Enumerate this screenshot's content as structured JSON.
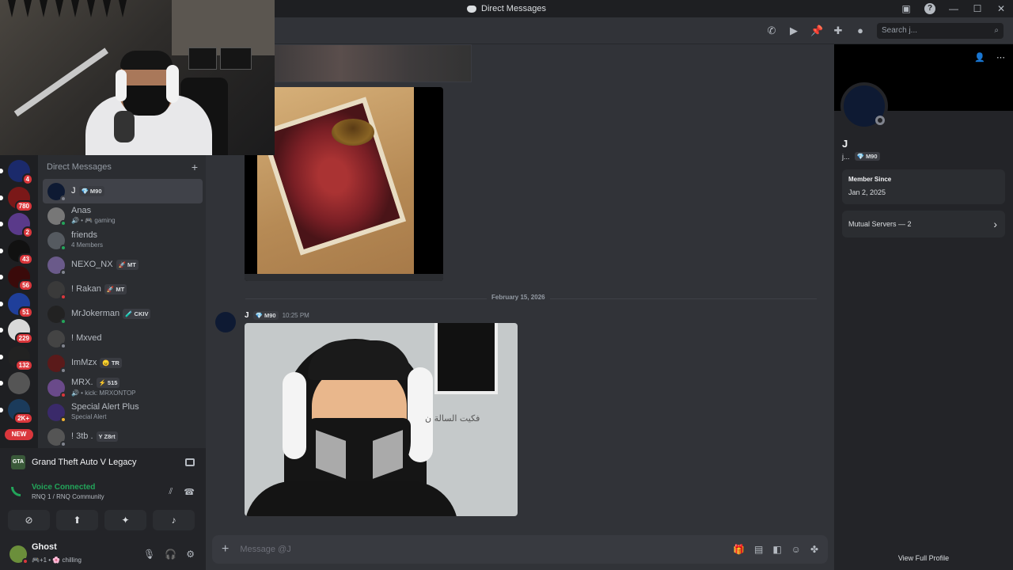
{
  "window": {
    "title": "Direct Messages",
    "minimize": "—",
    "maximize": "☐",
    "close": "✕",
    "help": "?"
  },
  "servers": [
    {
      "badge": "4",
      "color": "#1b2a6b"
    },
    {
      "badge": "780",
      "color": "#7a1818"
    },
    {
      "badge": "2",
      "color": "#5a3a8a"
    },
    {
      "badge": "43",
      "color": "#111111"
    },
    {
      "badge": "56",
      "color": "#3a0a0a"
    },
    {
      "badge": "51",
      "color": "#1f3f9a"
    },
    {
      "badge": "229",
      "color": "#d9d9d9"
    },
    {
      "badge": "132",
      "color": "#222222"
    },
    {
      "badge": "",
      "color": "#555555"
    },
    {
      "badge": "2K+",
      "color": "#1b3b5b"
    }
  ],
  "new_pill": "NEW",
  "dm_list": {
    "header": "Direct Messages",
    "add": "+",
    "items": [
      {
        "name": "J",
        "tag": "💎 M90",
        "sub": "",
        "avatar": "#0e1a33",
        "status": "#80848e",
        "active": true
      },
      {
        "name": "Anas",
        "tag": "",
        "sub": "🔊 • 🎮 gaming",
        "avatar": "#777777",
        "status": "#23a55a",
        "active": false
      },
      {
        "name": "friends",
        "tag": "",
        "sub": "4 Members",
        "avatar": "#555a60",
        "status": "#23a55a",
        "active": false
      },
      {
        "name": "NEXO_NX",
        "tag": "🚀 MT",
        "sub": "",
        "avatar": "#6a5a8a",
        "status": "#80848e",
        "active": false
      },
      {
        "name": "! Rakan",
        "tag": "🚀 MT",
        "sub": "",
        "avatar": "#3a3a3a",
        "status": "#da373c",
        "active": false
      },
      {
        "name": "MrJokerman",
        "tag": "🧪 CKIV",
        "sub": "",
        "avatar": "#222222",
        "status": "#23a55a",
        "active": false
      },
      {
        "name": "! Mxved",
        "tag": "",
        "sub": "",
        "avatar": "#444444",
        "status": "#80848e",
        "active": false
      },
      {
        "name": "ImMzx",
        "tag": "😠 TR",
        "sub": "",
        "avatar": "#5a1a1a",
        "status": "#80848e",
        "active": false
      },
      {
        "name": "MRX.",
        "tag": "⚡ 515",
        "sub": "🔊 • kick: MRXONTOP",
        "avatar": "#6a4a8a",
        "status": "#da373c",
        "active": false
      },
      {
        "name": "Special Alert Plus",
        "tag": "",
        "sub": "Special Alert",
        "avatar": "#3a2a6a",
        "status": "#f0b232",
        "active": false
      },
      {
        "name": "! 3tb .",
        "tag": "Y Z8rt",
        "sub": "",
        "avatar": "#555555",
        "status": "#80848e",
        "active": false
      }
    ]
  },
  "activity": {
    "game": "Grand Theft Auto V Legacy",
    "game_icon": "GTA",
    "voice_title": "Voice Connected",
    "voice_sub": "RNQ 1 / RNQ Community"
  },
  "user": {
    "name": "Ghost",
    "status": "🎮+1 • 🌸 chilling"
  },
  "toolbar": {
    "search_placeholder": "Search j..."
  },
  "chat": {
    "date_divider": "February 15, 2026",
    "message_author": "J",
    "message_tag": "💎 M90",
    "message_time": "10:25 PM",
    "image_handwriting": "فكيت السالة ن",
    "composer_placeholder": "Message @J"
  },
  "profile": {
    "name": "J",
    "handle": "j...",
    "tag": "💎 M90",
    "member_since_label": "Member Since",
    "member_since_value": "Jan 2, 2025",
    "mutual_servers": "Mutual Servers — 2",
    "view_full": "View Full Profile"
  }
}
